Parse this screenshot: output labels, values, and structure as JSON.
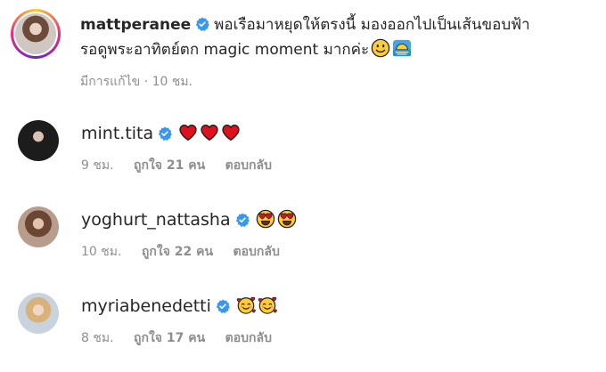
{
  "post": {
    "username": "mattperanee",
    "caption_line1": "พอเรือมาหยุดให้ตรงนี้ มองออกไปเป็นเส้นขอบฟ้า",
    "caption_line2": "รอดูพระอาทิตย์ตก magic moment มากค่ะ",
    "edited_label": "มีการแก้ไข",
    "separator": "·",
    "time": "10 ชม."
  },
  "comments": [
    {
      "username": "mint.tita",
      "emojis": [
        "heart",
        "heart",
        "heart"
      ],
      "time": "9 ชม.",
      "likes": "ถูกใจ 21 คน",
      "reply": "ตอบกลับ"
    },
    {
      "username": "yoghurt_nattasha",
      "emojis": [
        "heart-eyes",
        "heart-eyes"
      ],
      "time": "10 ชม.",
      "likes": "ถูกใจ 22 คน",
      "reply": "ตอบกลับ"
    },
    {
      "username": "myriabenedetti",
      "emojis": [
        "smiling-hearts",
        "smiling-hearts"
      ],
      "time": "8 ชม.",
      "likes": "ถูกใจ 17 คน",
      "reply": "ตอบกลับ"
    }
  ],
  "colors": {
    "verified_blue": "#3897f0",
    "meta_gray": "#8e8e8e",
    "text": "#262626",
    "heart_red": "#e0101f"
  }
}
